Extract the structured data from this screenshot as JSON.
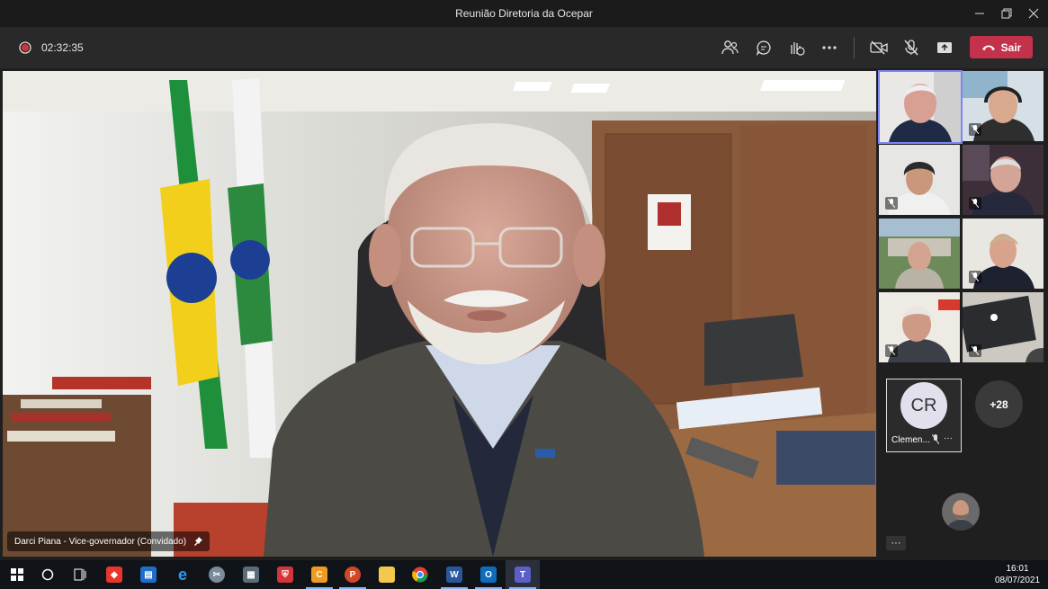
{
  "window": {
    "title": "Reunião Diretoria da Ocepar"
  },
  "toolbar": {
    "timer": "02:32:35",
    "leave_label": "Sair",
    "leave_color": "#c4314b"
  },
  "stage": {
    "speaker_label": "Darci Piana - Vice-governador (Convidado)"
  },
  "participants": {
    "cr_initials": "CR",
    "cr_name": "Clemen...",
    "overflow_count": "+28"
  },
  "taskbar": {
    "time": "16:01",
    "date": "08/07/2021",
    "apps": [
      {
        "name": "windows-start",
        "label": ""
      },
      {
        "name": "search",
        "label": ""
      },
      {
        "name": "task-view",
        "label": ""
      },
      {
        "name": "anydesk",
        "label": ""
      },
      {
        "name": "mail",
        "label": ""
      },
      {
        "name": "edge",
        "label": "e"
      },
      {
        "name": "snipping",
        "label": ""
      },
      {
        "name": "calculator",
        "label": ""
      },
      {
        "name": "security",
        "label": ""
      },
      {
        "name": "app-orange",
        "label": "C"
      },
      {
        "name": "powerpoint",
        "label": "P"
      },
      {
        "name": "file-explorer",
        "label": ""
      },
      {
        "name": "chrome",
        "label": ""
      },
      {
        "name": "word",
        "label": "W"
      },
      {
        "name": "outlook",
        "label": "O"
      },
      {
        "name": "teams",
        "label": "T"
      }
    ]
  }
}
